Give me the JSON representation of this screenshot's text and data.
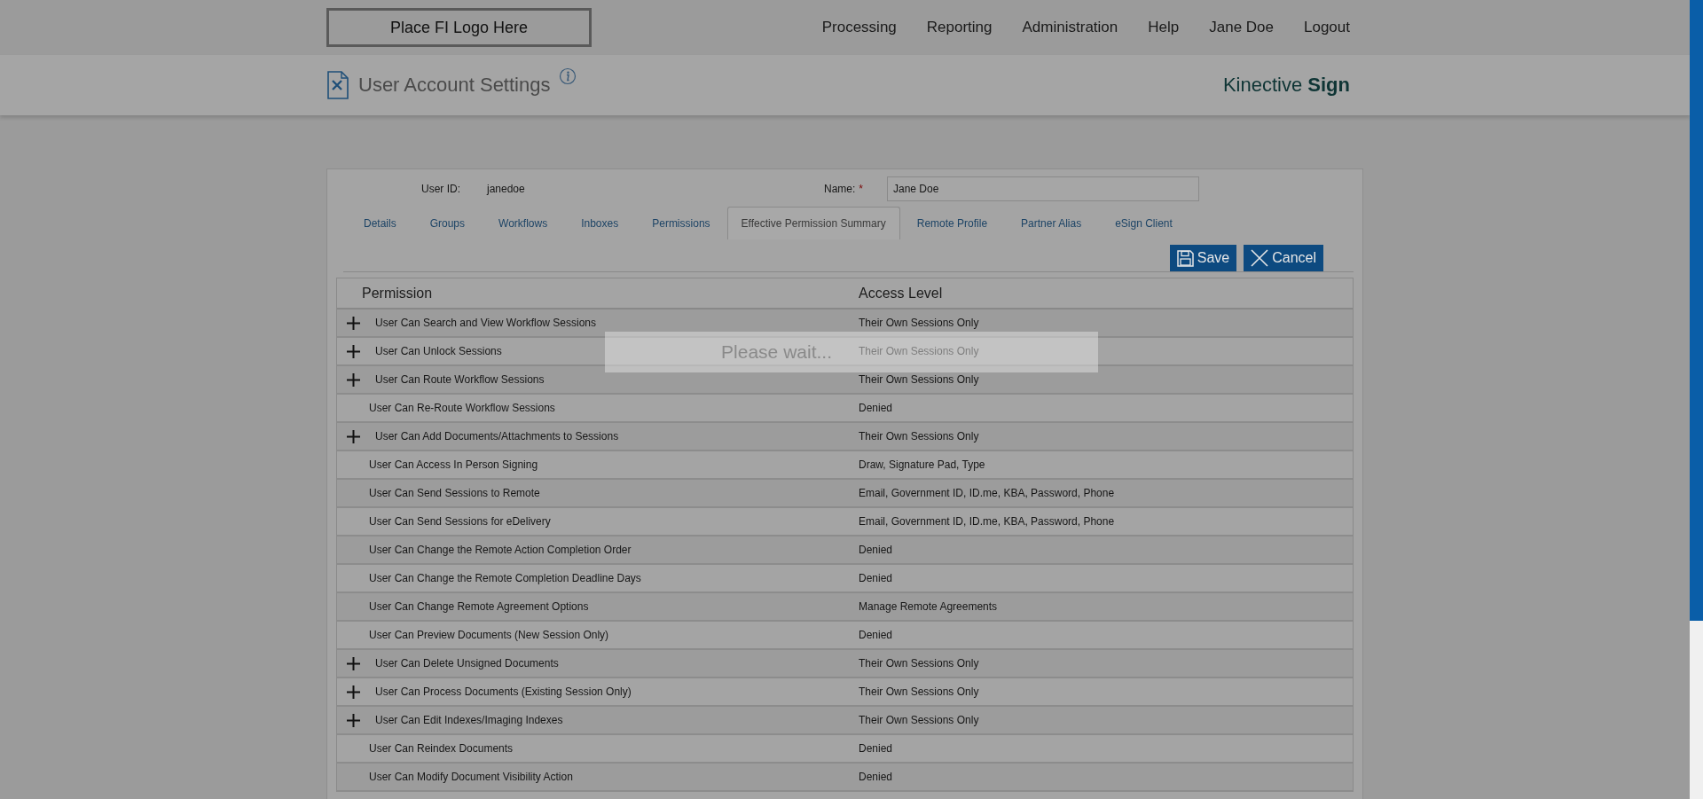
{
  "header": {
    "logo_text": "Place FI Logo Here",
    "nav": [
      "Processing",
      "Reporting",
      "Administration",
      "Help",
      "Jane Doe",
      "Logout"
    ]
  },
  "page": {
    "title": "User Account Settings",
    "brand": "Kinective",
    "brand_bold": "Sign"
  },
  "user": {
    "id_label": "User ID:",
    "id_value": "janedoe",
    "name_label": "Name:",
    "required_mark": "*",
    "name_value": "Jane Doe"
  },
  "tabs": [
    {
      "label": "Details",
      "selected": false
    },
    {
      "label": "Groups",
      "selected": false
    },
    {
      "label": "Workflows",
      "selected": false
    },
    {
      "label": "Inboxes",
      "selected": false
    },
    {
      "label": "Permissions",
      "selected": false
    },
    {
      "label": "Effective Permission Summary",
      "selected": true
    },
    {
      "label": "Remote Profile",
      "selected": false
    },
    {
      "label": "Partner Alias",
      "selected": false
    },
    {
      "label": "eSign Client",
      "selected": false
    }
  ],
  "buttons": [
    {
      "kind": "save",
      "label": "Save"
    },
    {
      "kind": "cancel",
      "label": "Cancel"
    }
  ],
  "table": {
    "columns": [
      "Permission",
      "Access Level"
    ],
    "rows": [
      {
        "permission": "User Can Search and View Workflow Sessions",
        "access": "Their Own Sessions Only",
        "expandable": true
      },
      {
        "permission": "User Can Unlock Sessions",
        "access": "Their Own Sessions Only",
        "expandable": true
      },
      {
        "permission": "User Can Route Workflow Sessions",
        "access": "Their Own Sessions Only",
        "expandable": true
      },
      {
        "permission": "User Can Re-Route Workflow Sessions",
        "access": "Denied",
        "expandable": false
      },
      {
        "permission": "User Can Add Documents/Attachments to Sessions",
        "access": "Their Own Sessions Only",
        "expandable": true
      },
      {
        "permission": "User Can Access In Person Signing",
        "access": "Draw, Signature Pad, Type",
        "expandable": false
      },
      {
        "permission": "User Can Send Sessions to Remote",
        "access": "Email, Government ID, ID.me, KBA, Password, Phone",
        "expandable": false
      },
      {
        "permission": "User Can Send Sessions for eDelivery",
        "access": "Email, Government ID, ID.me, KBA, Password, Phone",
        "expandable": false
      },
      {
        "permission": "User Can Change the Remote Action Completion Order",
        "access": "Denied",
        "expandable": false
      },
      {
        "permission": "User Can Change the Remote Completion Deadline Days",
        "access": "Denied",
        "expandable": false
      },
      {
        "permission": "User Can Change Remote Agreement Options",
        "access": "Manage Remote Agreements",
        "expandable": false
      },
      {
        "permission": "User Can Preview Documents (New Session Only)",
        "access": "Denied",
        "expandable": false
      },
      {
        "permission": "User Can Delete Unsigned Documents",
        "access": "Their Own Sessions Only",
        "expandable": true
      },
      {
        "permission": "User Can Process Documents (Existing Session Only)",
        "access": "Their Own Sessions Only",
        "expandable": true
      },
      {
        "permission": "User Can Edit Indexes/Imaging Indexes",
        "access": "Their Own Sessions Only",
        "expandable": true
      },
      {
        "permission": "User Can Reindex Documents",
        "access": "Denied",
        "expandable": false
      },
      {
        "permission": "User Can Modify Document Visibility Action",
        "access": "Denied",
        "expandable": false
      }
    ]
  },
  "loading": {
    "message": "Please wait..."
  }
}
